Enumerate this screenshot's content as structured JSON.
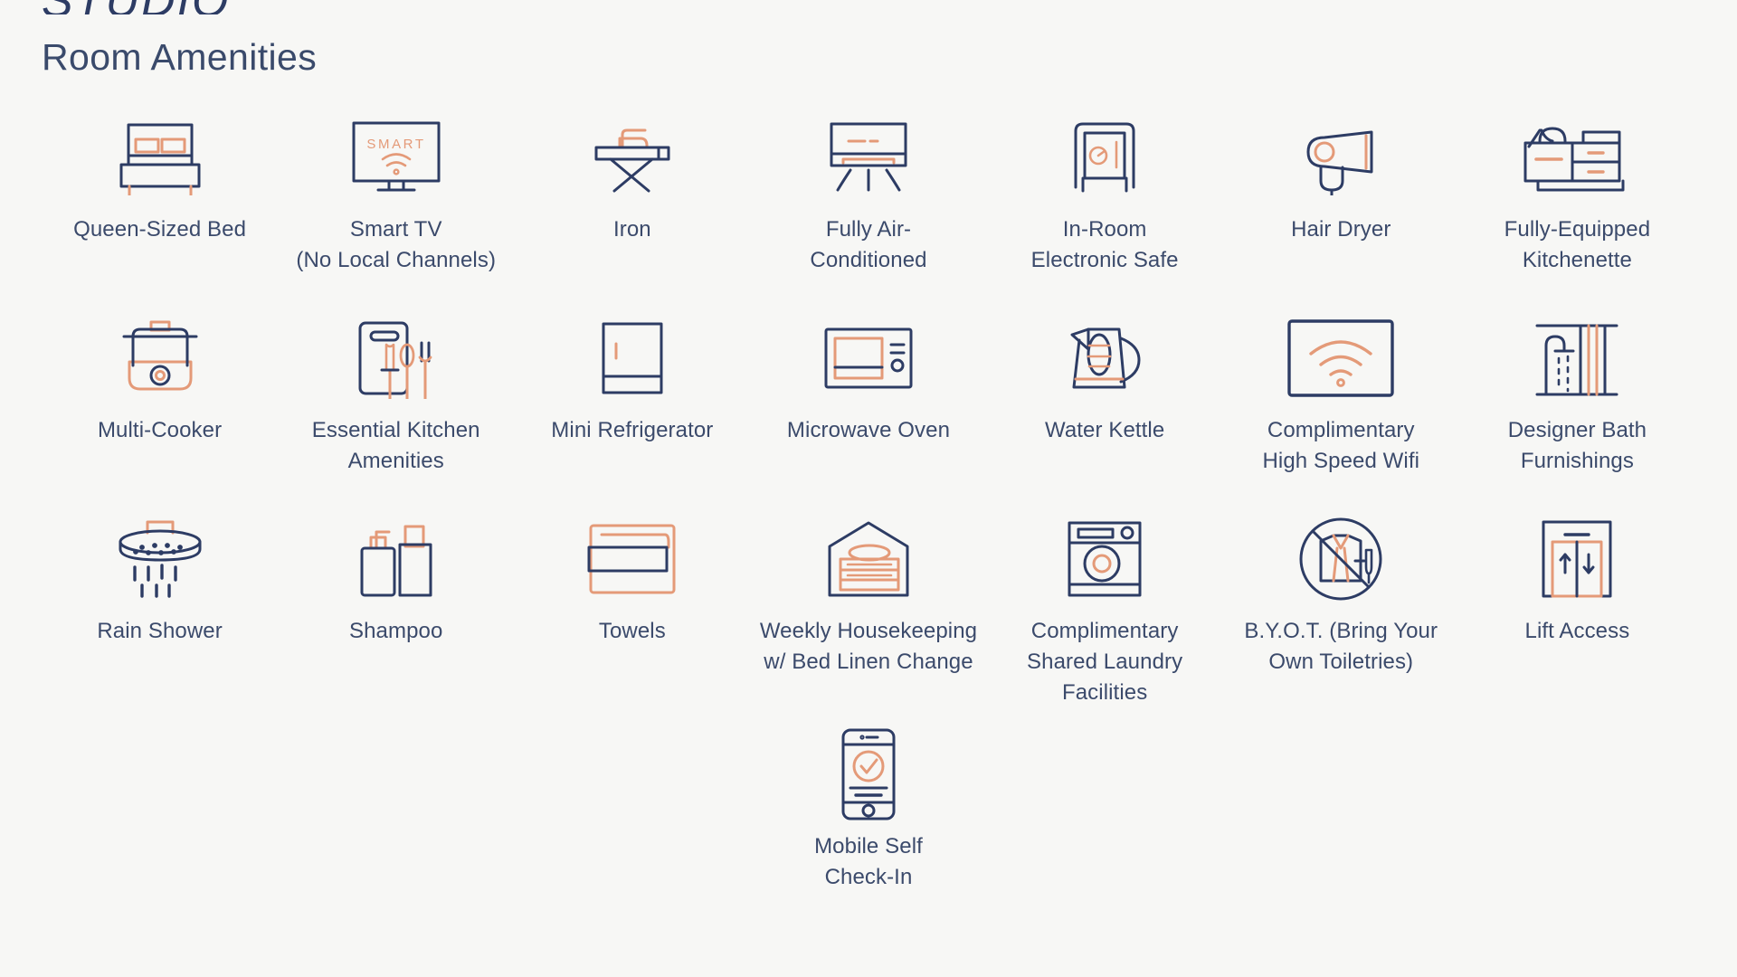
{
  "header": {
    "brand": "STUDIO",
    "section_title": "Room Amenities"
  },
  "colors": {
    "background": "#f7f7f5",
    "navy": "#2d3c64",
    "salmon": "#e49a78",
    "text": "#3b4a6b"
  },
  "amenities": [
    {
      "icon": "bed-icon",
      "label": "Queen-Sized Bed"
    },
    {
      "icon": "smart-tv-icon",
      "label": "Smart TV\n(No Local Channels)",
      "screen_text": "SMART"
    },
    {
      "icon": "iron-board-icon",
      "label": "Iron"
    },
    {
      "icon": "air-conditioner-icon",
      "label": "Fully Air-\nConditioned"
    },
    {
      "icon": "safe-icon",
      "label": "In-Room\nElectronic Safe"
    },
    {
      "icon": "hair-dryer-icon",
      "label": "Hair Dryer"
    },
    {
      "icon": "kitchenette-icon",
      "label": "Fully-Equipped\nKitchenette"
    },
    {
      "icon": "multi-cooker-icon",
      "label": "Multi-Cooker"
    },
    {
      "icon": "kitchen-utensils-icon",
      "label": "Essential Kitchen\nAmenities"
    },
    {
      "icon": "mini-fridge-icon",
      "label": "Mini Refrigerator"
    },
    {
      "icon": "microwave-icon",
      "label": "Microwave Oven"
    },
    {
      "icon": "kettle-icon",
      "label": "Water Kettle"
    },
    {
      "icon": "wifi-icon",
      "label": "Complimentary\nHigh Speed Wifi"
    },
    {
      "icon": "shower-curtain-icon",
      "label": "Designer Bath\nFurnishings"
    },
    {
      "icon": "rain-shower-icon",
      "label": "Rain Shower"
    },
    {
      "icon": "shampoo-bottles-icon",
      "label": "Shampoo"
    },
    {
      "icon": "towels-icon",
      "label": "Towels"
    },
    {
      "icon": "housekeeping-icon",
      "label": "Weekly Housekeeping\nw/ Bed Linen Change"
    },
    {
      "icon": "washing-machine-icon",
      "label": "Complimentary\nShared Laundry\nFacilities"
    },
    {
      "icon": "no-toiletries-icon",
      "label": "B.Y.O.T. (Bring Your\nOwn Toiletries)"
    },
    {
      "icon": "elevator-icon",
      "label": "Lift Access"
    },
    {
      "icon": "mobile-checkin-icon",
      "label": "Mobile Self\nCheck-In"
    }
  ]
}
